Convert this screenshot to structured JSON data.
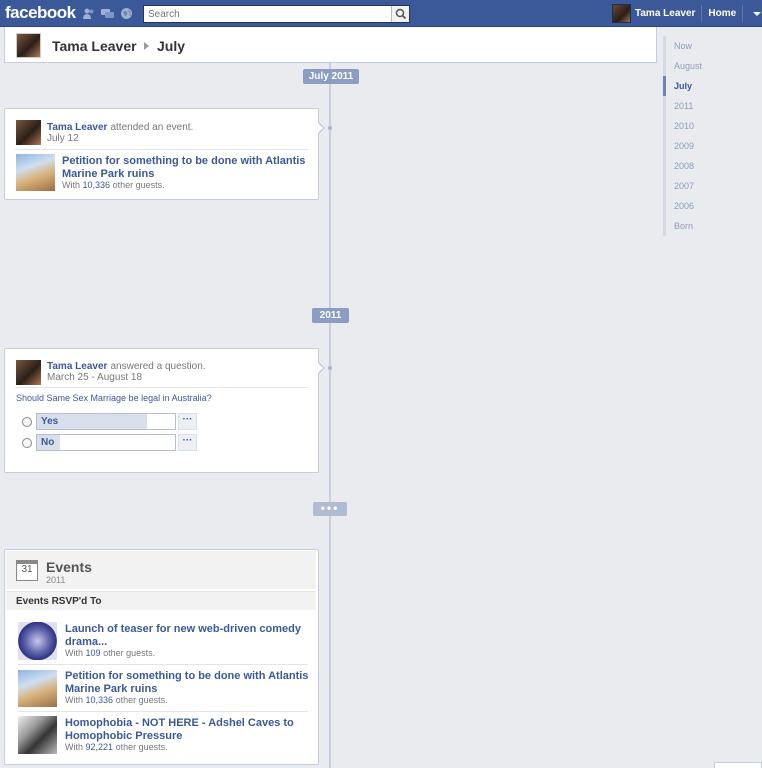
{
  "topbar": {
    "logo": "facebook",
    "search_placeholder": "Search",
    "user_name": "Tama Leaver",
    "home_label": "Home"
  },
  "header": {
    "name": "Tama Leaver",
    "month": "July"
  },
  "markers": {
    "july": "July 2011",
    "year": "2011",
    "more": "•••"
  },
  "event_story": {
    "actor": "Tama Leaver",
    "verb": "attended an event.",
    "date": "July 12",
    "event_title": "Petition for something to be done with Atlantis Marine Park ruins",
    "guests_prefix": "With",
    "guests_count": "10,336",
    "guests_suffix": "other guests."
  },
  "question_story": {
    "actor": "Tama Leaver",
    "verb": "answered a question.",
    "date": "March 25 - August 18",
    "question": "Should Same Sex Marriage be legal in Australia?",
    "options": [
      {
        "label": "Yes",
        "fill": 0.8
      },
      {
        "label": "No",
        "fill": 0.17
      }
    ],
    "more_label": "···"
  },
  "events_box": {
    "calendar_day": "31",
    "title": "Events",
    "year": "2011",
    "section": "Events RSVP'd To",
    "items": [
      {
        "title": "Launch of teaser for new web-driven comedy drama...",
        "prefix": "With",
        "count": "109",
        "suffix": "other guests."
      },
      {
        "title": "Petition for something to be done with Atlantis Marine Park ruins",
        "prefix": "With",
        "count": "10,336",
        "suffix": "other guests."
      },
      {
        "title": "Homophobia - NOT HERE - Adshel Caves to Homophobic Pressure",
        "prefix": "With",
        "count": "92,221",
        "suffix": "other guests."
      }
    ]
  },
  "year_nav": [
    "Now",
    "August",
    "July",
    "2011",
    "2010",
    "2009",
    "2008",
    "2007",
    "2006",
    "Born"
  ],
  "year_nav_active": "July",
  "colors": {
    "topbar": "#3b5998",
    "link": "#3b5998",
    "marker": "#8b9dc3",
    "background": "#e9ebee"
  }
}
